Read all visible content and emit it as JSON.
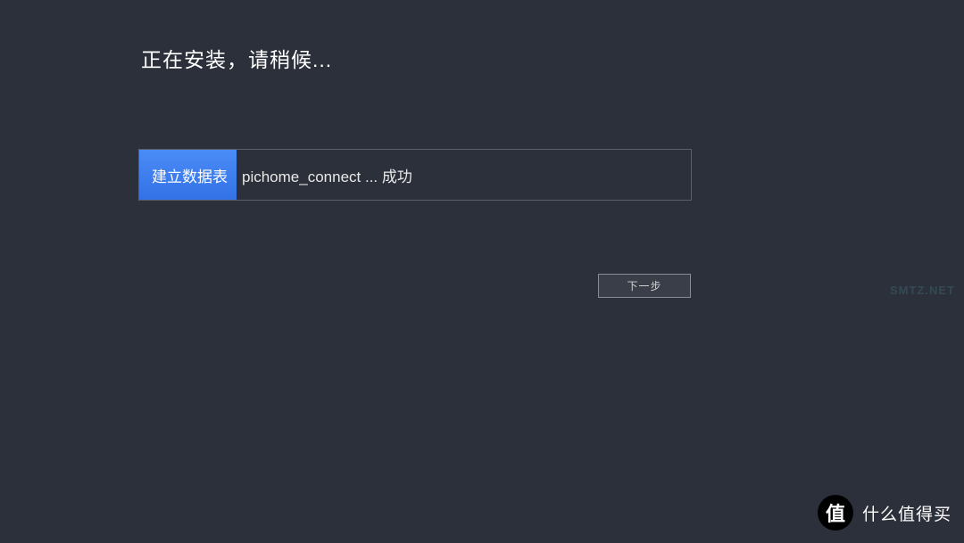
{
  "heading": "正在安装，请稍候...",
  "log": {
    "highlight_prefix": "建立数据表",
    "rest": " pichome_connect ... 成功"
  },
  "actions": {
    "next_label": "下一步"
  },
  "watermark": {
    "side": "SMTZ.NET"
  },
  "brand": {
    "logo_char": "值",
    "text": "什么值得买"
  }
}
